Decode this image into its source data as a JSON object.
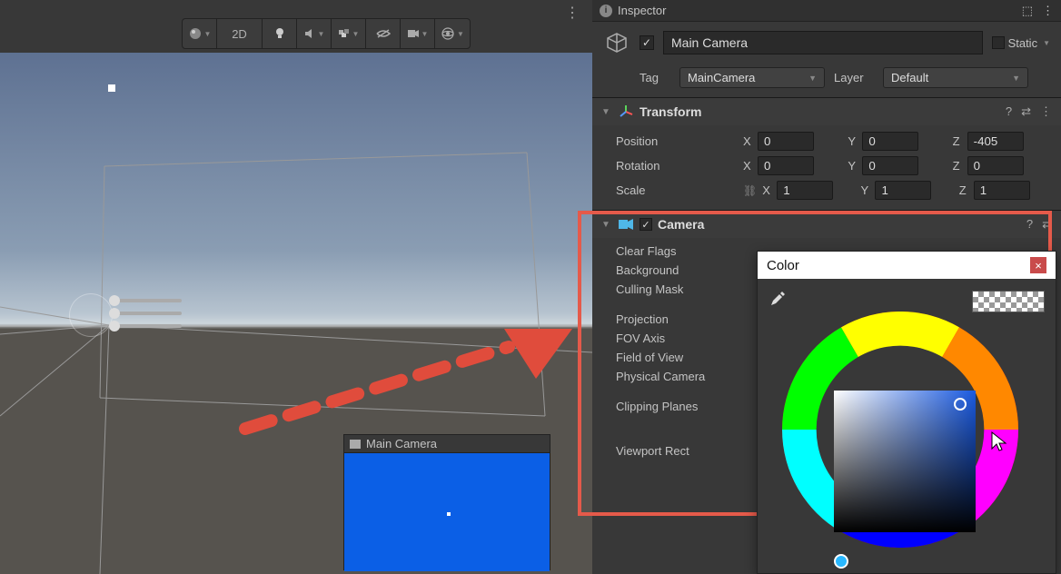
{
  "scene": {
    "toolbar": {
      "twoD": "2D"
    },
    "preview_title": "Main Camera"
  },
  "inspector": {
    "tab_title": "Inspector",
    "object_name": "Main Camera",
    "static_label": "Static",
    "tag_label": "Tag",
    "tag_value": "MainCamera",
    "layer_label": "Layer",
    "layer_value": "Default"
  },
  "transform": {
    "title": "Transform",
    "position_label": "Position",
    "rotation_label": "Rotation",
    "scale_label": "Scale",
    "pos": {
      "x": "0",
      "y": "0",
      "z": "-405"
    },
    "rot": {
      "x": "0",
      "y": "0",
      "z": "0"
    },
    "scale": {
      "x": "1",
      "y": "1",
      "z": "1"
    },
    "axis_x": "X",
    "axis_y": "Y",
    "axis_z": "Z"
  },
  "camera": {
    "title": "Camera",
    "clear_flags": "Clear Flags",
    "background": "Background",
    "culling_mask": "Culling Mask",
    "projection": "Projection",
    "fov_axis": "FOV Axis",
    "field_of_view": "Field of View",
    "physical_camera": "Physical Camera",
    "clipping_planes": "Clipping Planes",
    "viewport_rect": "Viewport Rect"
  },
  "color_picker": {
    "title": "Color"
  },
  "colors": {
    "highlight": "#e55a4a",
    "camera_preview": "#0b5fe6",
    "panel_bg": "#383838"
  }
}
